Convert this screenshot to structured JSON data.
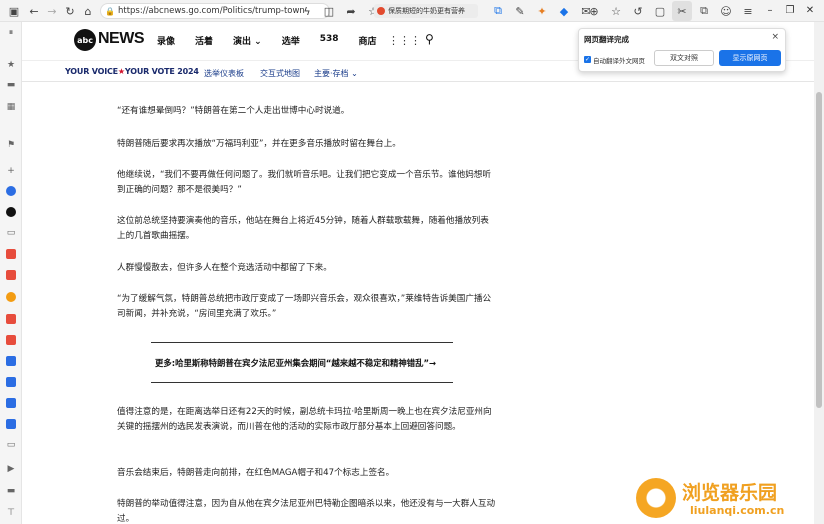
{
  "browser": {
    "url": "https://abcnews.go.com/Politics/trump-town-",
    "ext_tab_label": "保质期短的牛奶更有营养",
    "nav_buttons": {
      "back": "←",
      "forward": "→",
      "reload": "↻",
      "home": "⌂"
    }
  },
  "site": {
    "logo_text": "abc",
    "name": "NEWS",
    "nav": [
      "录像",
      "活着",
      "演出 ⌄",
      "选举",
      "538",
      "商店"
    ],
    "subnav_brand_left": "YOUR VOICE",
    "subnav_brand_star": "★",
    "subnav_brand_right": "YOUR VOTE 2024",
    "subnav_links": [
      "选举仪表板",
      "交互式地图",
      "主要·存档 ⌄"
    ]
  },
  "article": {
    "paragraphs": [
      "“还有谁想晕倒吗？”特朗普在第二个人走出世博中心时说道。",
      "特朗普随后要求再次播放“万福玛利亚”，并在更多音乐播放时留在舞台上。",
      "他继续说，“我们不要再做任何问题了。我们就听音乐吧。让我们把它变成一个音乐节。谁他妈想听到正确的问题？那不是很美吗？”",
      "这位前总统坚持要演奏他的音乐，他站在舞台上将近45分钟，随着人群载歌载舞，随着他播放列表上的几首歌曲摇摆。",
      "人群慢慢散去，但许多人在整个竞选活动中都留了下来。",
      "“为了缓解气氛，特朗普总统把市政厅变成了一场即兴音乐会，观众很喜欢，”莱维特告诉美国广播公司新闻，并补充说，“房间里充满了欢乐。”",
      "值得注意的是，在距离选举日还有22天的时候，副总统卡玛拉·哈里斯周一晚上也在宾夕法尼亚州向关键的摇摆州的选民发表演说，而川普在他的活动的实际市政厅部分基本上回避回答问题。",
      "音乐会结束后，特朗普走向前排，在红色MAGA帽子和47个标志上签名。",
      "特朗普的举动值得注意，因为自从他在宾夕法尼亚州巴特勒企图暗杀以来，他还没有与一大群人互动过。"
    ],
    "more_link": "更多:哈里斯称特朗普在宾夕法尼亚州集会期间“越来越不稳定和精神错乱”→"
  },
  "popup": {
    "title": "网页翻译完成",
    "close": "×",
    "auto_label": "自动翻译外文网页",
    "btn_bilingual": "双文对照",
    "btn_original": "显示原网页"
  },
  "watermark": {
    "text": "浏览器乐园",
    "url": "liulanqi.com.cn"
  },
  "colors": {
    "accent_blue": "#1a73e8",
    "abc_navy": "#1a2a6c",
    "vote_red": "#d2142d",
    "watermark_orange": "#f0a020"
  }
}
